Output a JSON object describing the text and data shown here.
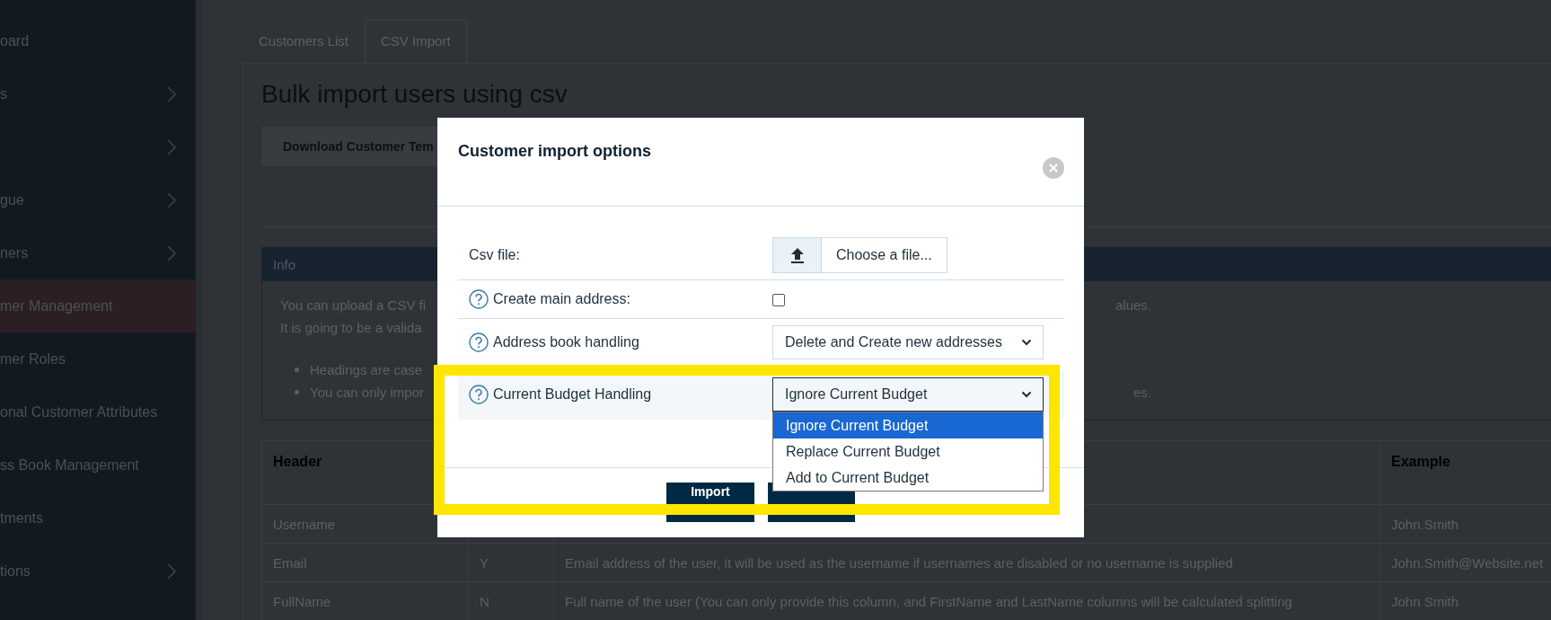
{
  "sidebar": {
    "items": [
      {
        "label": "oard",
        "expandable": false,
        "selected": false
      },
      {
        "label": "s",
        "expandable": true,
        "selected": false
      },
      {
        "expandable": true,
        "selected": false
      },
      {
        "label": "gue",
        "expandable": true,
        "selected": false
      },
      {
        "label": "ners",
        "expandable": true,
        "selected": false
      },
      {
        "label": "mer Management",
        "expandable": false,
        "selected": true
      },
      {
        "label": "mer Roles",
        "expandable": false,
        "selected": false
      },
      {
        "label": "onal Customer Attributes",
        "expandable": false,
        "selected": false
      },
      {
        "label": "ss Book Management",
        "expandable": false,
        "selected": false
      },
      {
        "label": "tments",
        "expandable": false,
        "selected": false
      },
      {
        "label": "tions",
        "expandable": true,
        "selected": false
      }
    ]
  },
  "tabs": [
    {
      "label": "Customers List",
      "selected": false
    },
    {
      "label": "CSV Import",
      "selected": true
    }
  ],
  "page_title": "Bulk import users using csv",
  "download_button": "Download Customer Tem",
  "info": {
    "header": "Info",
    "lines": [
      {
        "left": "You can upload a CSV fi",
        "right": "alues."
      },
      {
        "left": "It is going to be a valida"
      }
    ],
    "bullets": [
      {
        "left": "Headings are case"
      },
      {
        "left": "You can only impor",
        "right": "es."
      }
    ]
  },
  "table": {
    "columns": [
      "Header",
      null,
      null,
      "Example"
    ],
    "rows": [
      [
        "Username",
        null,
        null,
        "John.Smith"
      ],
      [
        "Email",
        "Y",
        "Email address of the user, it will be used as the username if usernames are disabled or no username is supplied",
        "John.Smith@Website.net"
      ],
      [
        "FullName",
        "N",
        "Full name of the user (You can only provide this column, and FirstName and LastName columns will be calculated splitting",
        "John Smith"
      ]
    ]
  },
  "modal": {
    "title": "Customer import options",
    "rows": [
      {
        "kind": "file",
        "label": "Csv file:",
        "help": false,
        "button": "Choose a file..."
      },
      {
        "kind": "checkbox",
        "label": "Create main address:",
        "help": true,
        "checked": false
      },
      {
        "kind": "select",
        "label": "Address book handling",
        "help": true,
        "value": "Delete and Create new addresses",
        "open": false,
        "highlighted": false
      },
      {
        "kind": "select",
        "label": "Current Budget Handling",
        "help": true,
        "value": "Ignore Current Budget",
        "open": true,
        "highlighted": true,
        "options": [
          {
            "label": "Ignore Current Budget",
            "selected": true
          },
          {
            "label": "Replace Current Budget",
            "selected": false
          },
          {
            "label": "Add to Current Budget",
            "selected": false
          }
        ]
      }
    ],
    "primary_button": "Import",
    "secondary_button": true
  },
  "annotation_box": true
}
